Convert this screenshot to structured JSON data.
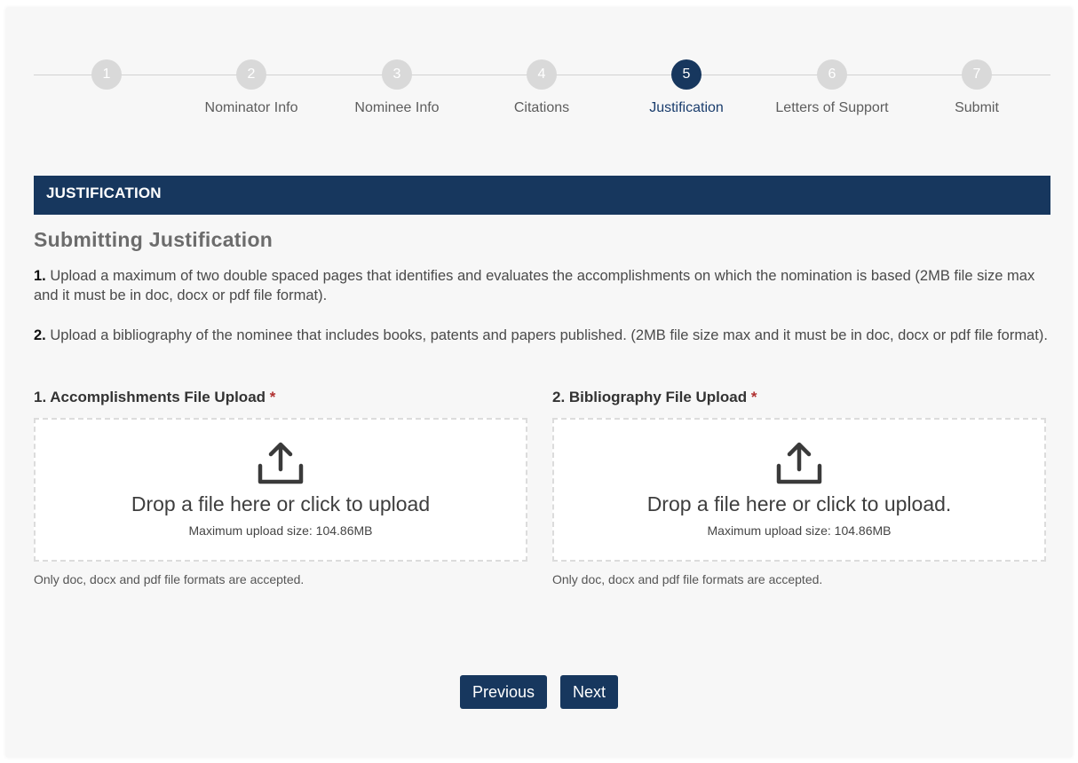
{
  "stepper": {
    "steps": [
      {
        "number": "1",
        "label": ""
      },
      {
        "number": "2",
        "label": "Nominator Info"
      },
      {
        "number": "3",
        "label": "Nominee Info"
      },
      {
        "number": "4",
        "label": "Citations"
      },
      {
        "number": "5",
        "label": "Justification"
      },
      {
        "number": "6",
        "label": "Letters of Support"
      },
      {
        "number": "7",
        "label": "Submit"
      }
    ],
    "active_step": 5
  },
  "section": {
    "header": "JUSTIFICATION",
    "heading": "Submitting Justification"
  },
  "instructions": [
    {
      "num": "1.",
      "text": " Upload a maximum of two double spaced pages that identifies and evaluates the accomplishments on which the nomination is based (2MB file size max and it must be in doc, docx or pdf file format)."
    },
    {
      "num": "2.",
      "text": " Upload a bibliography of the nominee that includes books, patents and papers published. (2MB file size max and it must be in doc, docx or pdf file format)."
    }
  ],
  "uploads": [
    {
      "title": "1. Accomplishments File Upload",
      "required_mark": "*",
      "drop_text": "Drop a file here or click to upload",
      "max_size": "Maximum upload size: 104.86MB",
      "note": "Only doc, docx and pdf file formats are accepted."
    },
    {
      "title": "2. Bibliography File Upload",
      "required_mark": "*",
      "drop_text": "Drop a file here or click to upload.",
      "max_size": "Maximum upload size: 104.86MB",
      "note": "Only doc, docx and pdf file formats are accepted."
    }
  ],
  "buttons": {
    "previous": "Previous",
    "next": "Next"
  },
  "colors": {
    "primary": "#17375e",
    "required": "#b03030",
    "inactive_step": "#d9d9d9"
  },
  "icons": {
    "upload": "upload-arrow-tray"
  }
}
